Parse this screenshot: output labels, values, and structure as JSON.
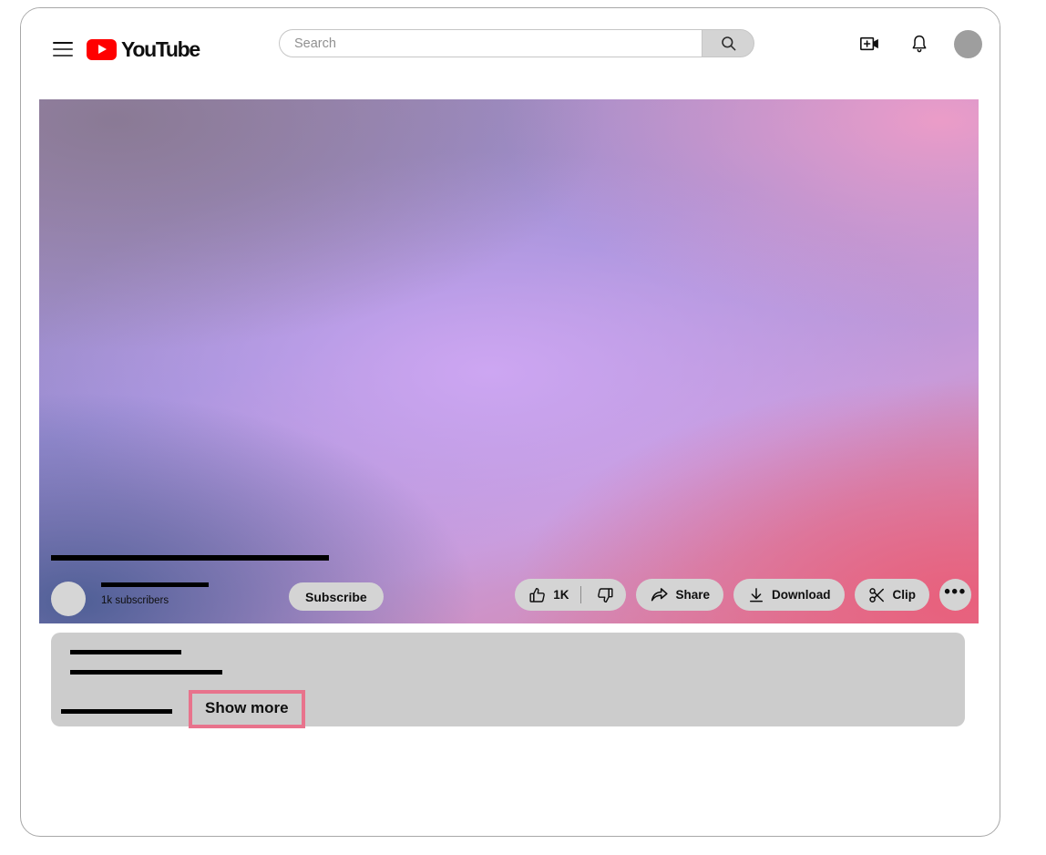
{
  "window": {
    "app": "YouTube"
  },
  "header": {
    "menu_icon": "hamburger-menu-icon",
    "logo_text": "YouTube",
    "logo_icon": "youtube-play-icon",
    "search": {
      "value": "",
      "placeholder": "Search",
      "button_icon": "search-icon"
    },
    "create_icon": "create-video-icon",
    "notifications_icon": "bell-icon",
    "avatar_icon": "account-avatar"
  },
  "player": {
    "icon": "video-player",
    "gradient": {
      "top_left": "#8a7a95",
      "top_right": "#eb9cc8",
      "bottom_left": "#4f5f96",
      "bottom_right": "#e8607c",
      "center": "#cda6f2"
    }
  },
  "video": {
    "title": "",
    "channel_name": "",
    "subscriber_count": "1k subscribers",
    "subscribe_label": "Subscribe"
  },
  "actions": {
    "like_count": "1K",
    "like_icon": "thumbs-up-icon",
    "dislike_icon": "thumbs-down-icon",
    "share_label": "Share",
    "share_icon": "share-arrow-icon",
    "download_label": "Download",
    "download_icon": "download-arrow-icon",
    "clip_label": "Clip",
    "clip_icon": "scissors-icon",
    "more_label": "•••",
    "more_icon": "more-horizontal-icon"
  },
  "description": {
    "line_1": "",
    "line_2": "",
    "line_3": "",
    "show_more_label": "Show more",
    "highlight_color": "#e8738c"
  }
}
